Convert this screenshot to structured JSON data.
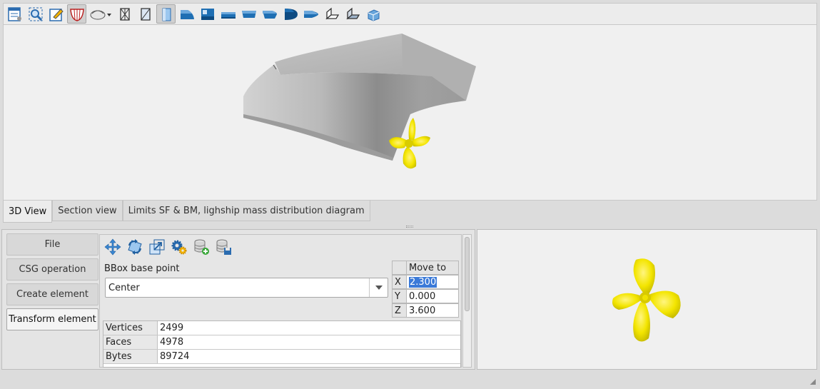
{
  "toolbar": {
    "icons": [
      "properties-icon",
      "zoom-fit-icon",
      "edit-icon",
      "hull-icon",
      "lighting-icon",
      "wireframe-icon",
      "flat-shading-icon",
      "box-view-icon",
      "stern-view-icon",
      "section-view-icon",
      "profile-view-icon",
      "side-view-icon",
      "bow-view-icon",
      "front-view-icon",
      "top-view-icon",
      "iso-view-1-icon",
      "iso-view-2-icon",
      "iso-view-3-icon"
    ]
  },
  "tabs": [
    {
      "label": "3D View",
      "active": true
    },
    {
      "label": "Section view",
      "active": false
    },
    {
      "label": "Limits SF & BM, lighship mass distribution diagram",
      "active": false
    }
  ],
  "sidebar": {
    "items": [
      {
        "label": "File",
        "active": false
      },
      {
        "label": "CSG operation",
        "active": false
      },
      {
        "label": "Create element",
        "active": false
      },
      {
        "label": "Transform element",
        "active": true
      }
    ]
  },
  "transform": {
    "tools": [
      "move-icon",
      "rotate-icon",
      "scale-icon",
      "settings-icon",
      "add-database-icon",
      "save-database-icon"
    ],
    "bbox_label": "BBox base point",
    "bbox_value": "Center",
    "move_to": {
      "header": "Move to",
      "rows": [
        {
          "axis": "X",
          "value": "2.300"
        },
        {
          "axis": "Y",
          "value": "0.000"
        },
        {
          "axis": "Z",
          "value": "3.600"
        }
      ]
    },
    "stats": [
      {
        "key": "Vertices",
        "value": "2499"
      },
      {
        "key": "Faces",
        "value": "4978"
      },
      {
        "key": "Bytes",
        "value": "89724"
      }
    ]
  },
  "colors": {
    "accent": "#1f6fb3",
    "propeller": "#f0e600",
    "hull": "#a8a8a8",
    "selection": "#3b7ad8"
  }
}
